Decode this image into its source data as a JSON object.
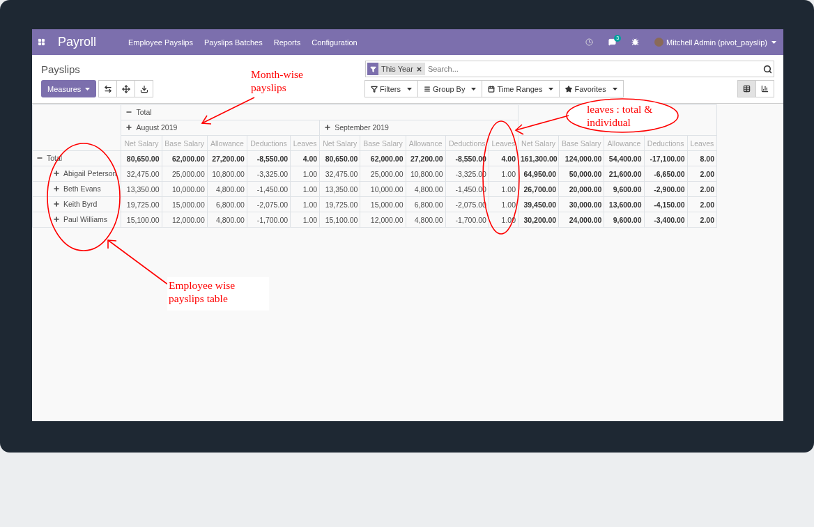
{
  "navbar": {
    "brand": "Payroll",
    "menu": [
      "Employee Payslips",
      "Payslips Batches",
      "Reports",
      "Configuration"
    ],
    "message_count": "3",
    "user": "Mitchell Admin (pivot_payslip)"
  },
  "control_panel": {
    "breadcrumb": "Payslips",
    "measures_button": "Measures",
    "search": {
      "facet": "This Year",
      "placeholder": "Search..."
    },
    "search_buttons": [
      {
        "kind": "filter",
        "label": "Filters"
      },
      {
        "kind": "group",
        "label": "Group By"
      },
      {
        "kind": "time",
        "label": "Time Ranges"
      },
      {
        "kind": "favorite",
        "label": "Favorites"
      }
    ],
    "views": [
      {
        "kind": "pivot",
        "selected": true
      },
      {
        "kind": "graph",
        "selected": false
      }
    ]
  },
  "pivot": {
    "column_total": {
      "label": "Total",
      "expanded": true
    },
    "column_groups": [
      {
        "label": "August 2019",
        "expanded": false
      },
      {
        "label": "September 2019",
        "expanded": false
      }
    ],
    "measures": [
      "Net Salary",
      "Base Salary",
      "Allowance",
      "Deductions",
      "Leaves",
      "Net Salary",
      "Base Salary",
      "Allowance",
      "Deductions",
      "Leaves",
      "Net Salary",
      "Base Salary",
      "Allowance",
      "Deductions",
      "Leaves"
    ],
    "rows": [
      {
        "kind": "total",
        "label": "Total",
        "expanded": true,
        "values": [
          "80,650.00",
          "62,000.00",
          "27,200.00",
          "-8,550.00",
          "4.00",
          "80,650.00",
          "62,000.00",
          "27,200.00",
          "-8,550.00",
          "4.00",
          "161,300.00",
          "124,000.00",
          "54,400.00",
          "-17,100.00",
          "8.00"
        ]
      },
      {
        "kind": "employee",
        "label": "Abigail Peterson",
        "expanded": false,
        "values": [
          "32,475.00",
          "25,000.00",
          "10,800.00",
          "-3,325.00",
          "1.00",
          "32,475.00",
          "25,000.00",
          "10,800.00",
          "-3,325.00",
          "1.00",
          "64,950.00",
          "50,000.00",
          "21,600.00",
          "-6,650.00",
          "2.00"
        ]
      },
      {
        "kind": "employee",
        "label": "Beth Evans",
        "expanded": false,
        "values": [
          "13,350.00",
          "10,000.00",
          "4,800.00",
          "-1,450.00",
          "1.00",
          "13,350.00",
          "10,000.00",
          "4,800.00",
          "-1,450.00",
          "1.00",
          "26,700.00",
          "20,000.00",
          "9,600.00",
          "-2,900.00",
          "2.00"
        ]
      },
      {
        "kind": "employee",
        "label": "Keith Byrd",
        "expanded": false,
        "values": [
          "19,725.00",
          "15,000.00",
          "6,800.00",
          "-2,075.00",
          "1.00",
          "19,725.00",
          "15,000.00",
          "6,800.00",
          "-2,075.00",
          "1.00",
          "39,450.00",
          "30,000.00",
          "13,600.00",
          "-4,150.00",
          "2.00"
        ]
      },
      {
        "kind": "employee",
        "label": "Paul Williams",
        "expanded": false,
        "values": [
          "15,100.00",
          "12,000.00",
          "4,800.00",
          "-1,700.00",
          "1.00",
          "15,100.00",
          "12,000.00",
          "4,800.00",
          "-1,700.00",
          "1.00",
          "30,200.00",
          "24,000.00",
          "9,600.00",
          "-3,400.00",
          "2.00"
        ]
      }
    ]
  },
  "annotations": [
    {
      "kind": "plain",
      "text": "Month-wise payslips"
    },
    {
      "kind": "bubble",
      "text": "leaves : total & individual"
    },
    {
      "kind": "boxed",
      "text": "Employee wise payslips table"
    }
  ]
}
